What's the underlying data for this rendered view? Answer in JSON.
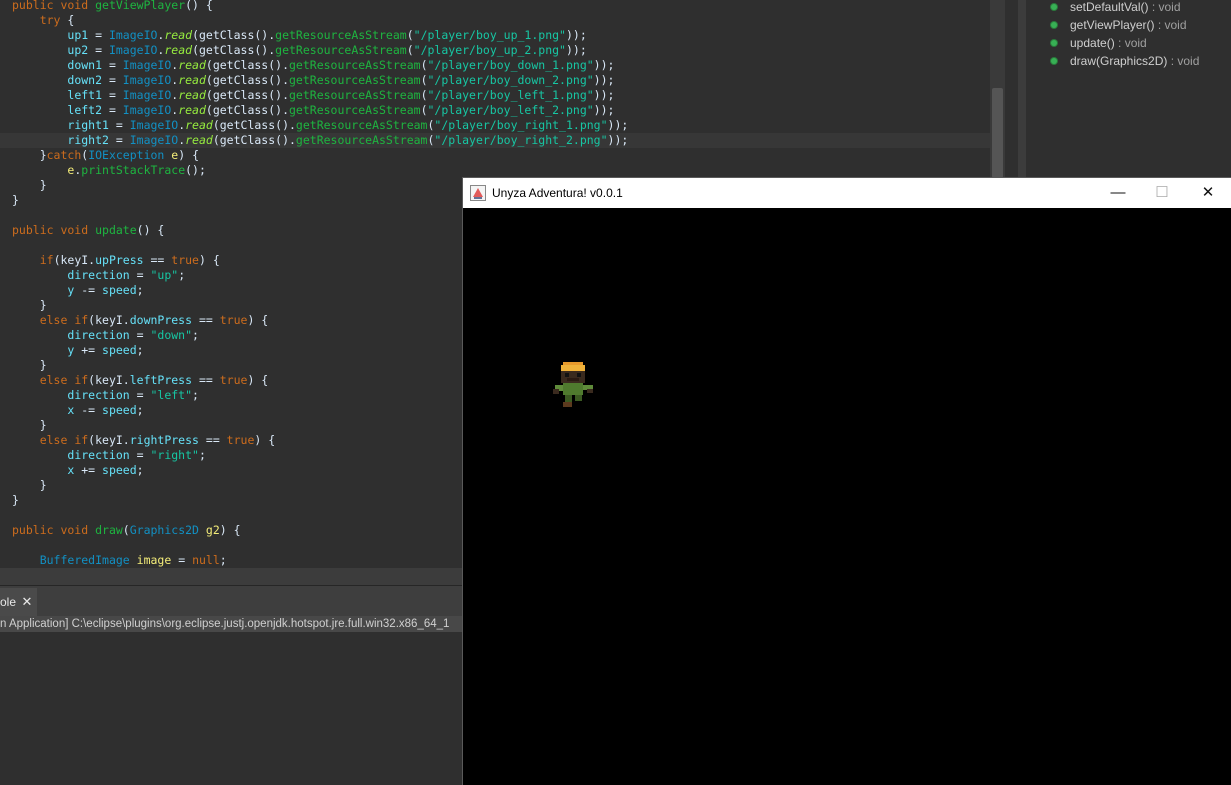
{
  "editor": {
    "lines": [
      [
        {
          "t": "public void ",
          "c": "kw"
        },
        {
          "t": "getViewPlayer",
          "c": "m"
        },
        {
          "t": "() {",
          "c": ""
        }
      ],
      [
        {
          "t": "    ",
          "c": ""
        },
        {
          "t": "try",
          "c": "kw"
        },
        {
          "t": " {",
          "c": ""
        }
      ],
      [
        {
          "t": "        ",
          "c": ""
        },
        {
          "t": "up1",
          "c": "f"
        },
        {
          "t": " = ",
          "c": ""
        },
        {
          "t": "ImageIO",
          "c": "ty"
        },
        {
          "t": ".",
          "c": ""
        },
        {
          "t": "read",
          "c": "st"
        },
        {
          "t": "(getClass().",
          "c": ""
        },
        {
          "t": "getResourceAsStream",
          "c": "m"
        },
        {
          "t": "(",
          "c": ""
        },
        {
          "t": "\"/player/boy_up_1.png\"",
          "c": "s"
        },
        {
          "t": "));",
          "c": ""
        }
      ],
      [
        {
          "t": "        ",
          "c": ""
        },
        {
          "t": "up2",
          "c": "f"
        },
        {
          "t": " = ",
          "c": ""
        },
        {
          "t": "ImageIO",
          "c": "ty"
        },
        {
          "t": ".",
          "c": ""
        },
        {
          "t": "read",
          "c": "st"
        },
        {
          "t": "(getClass().",
          "c": ""
        },
        {
          "t": "getResourceAsStream",
          "c": "m"
        },
        {
          "t": "(",
          "c": ""
        },
        {
          "t": "\"/player/boy_up_2.png\"",
          "c": "s"
        },
        {
          "t": "));",
          "c": ""
        }
      ],
      [
        {
          "t": "        ",
          "c": ""
        },
        {
          "t": "down1",
          "c": "f"
        },
        {
          "t": " = ",
          "c": ""
        },
        {
          "t": "ImageIO",
          "c": "ty"
        },
        {
          "t": ".",
          "c": ""
        },
        {
          "t": "read",
          "c": "st"
        },
        {
          "t": "(getClass().",
          "c": ""
        },
        {
          "t": "getResourceAsStream",
          "c": "m"
        },
        {
          "t": "(",
          "c": ""
        },
        {
          "t": "\"/player/boy_down_1.png\"",
          "c": "s"
        },
        {
          "t": "));",
          "c": ""
        }
      ],
      [
        {
          "t": "        ",
          "c": ""
        },
        {
          "t": "down2",
          "c": "f"
        },
        {
          "t": " = ",
          "c": ""
        },
        {
          "t": "ImageIO",
          "c": "ty"
        },
        {
          "t": ".",
          "c": ""
        },
        {
          "t": "read",
          "c": "st"
        },
        {
          "t": "(getClass().",
          "c": ""
        },
        {
          "t": "getResourceAsStream",
          "c": "m"
        },
        {
          "t": "(",
          "c": ""
        },
        {
          "t": "\"/player/boy_down_2.png\"",
          "c": "s"
        },
        {
          "t": "));",
          "c": ""
        }
      ],
      [
        {
          "t": "        ",
          "c": ""
        },
        {
          "t": "left1",
          "c": "f"
        },
        {
          "t": " = ",
          "c": ""
        },
        {
          "t": "ImageIO",
          "c": "ty"
        },
        {
          "t": ".",
          "c": ""
        },
        {
          "t": "read",
          "c": "st"
        },
        {
          "t": "(getClass().",
          "c": ""
        },
        {
          "t": "getResourceAsStream",
          "c": "m"
        },
        {
          "t": "(",
          "c": ""
        },
        {
          "t": "\"/player/boy_left_1.png\"",
          "c": "s"
        },
        {
          "t": "));",
          "c": ""
        }
      ],
      [
        {
          "t": "        ",
          "c": ""
        },
        {
          "t": "left2",
          "c": "f"
        },
        {
          "t": " = ",
          "c": ""
        },
        {
          "t": "ImageIO",
          "c": "ty"
        },
        {
          "t": ".",
          "c": ""
        },
        {
          "t": "read",
          "c": "st"
        },
        {
          "t": "(getClass().",
          "c": ""
        },
        {
          "t": "getResourceAsStream",
          "c": "m"
        },
        {
          "t": "(",
          "c": ""
        },
        {
          "t": "\"/player/boy_left_2.png\"",
          "c": "s"
        },
        {
          "t": "));",
          "c": ""
        }
      ],
      [
        {
          "t": "        ",
          "c": ""
        },
        {
          "t": "right1",
          "c": "f"
        },
        {
          "t": " = ",
          "c": ""
        },
        {
          "t": "ImageIO",
          "c": "ty"
        },
        {
          "t": ".",
          "c": ""
        },
        {
          "t": "read",
          "c": "st"
        },
        {
          "t": "(getClass().",
          "c": ""
        },
        {
          "t": "getResourceAsStream",
          "c": "m"
        },
        {
          "t": "(",
          "c": ""
        },
        {
          "t": "\"/player/boy_right_1.png\"",
          "c": "s"
        },
        {
          "t": "));",
          "c": ""
        }
      ],
      [
        {
          "t": "        ",
          "c": ""
        },
        {
          "t": "right2",
          "c": "f"
        },
        {
          "t": " = ",
          "c": ""
        },
        {
          "t": "ImageIO",
          "c": "ty"
        },
        {
          "t": ".",
          "c": ""
        },
        {
          "t": "read",
          "c": "st"
        },
        {
          "t": "(getClass().",
          "c": ""
        },
        {
          "t": "getResourceAsStream",
          "c": "m"
        },
        {
          "t": "(",
          "c": ""
        },
        {
          "t": "\"/player/boy_right_2.png\"",
          "c": "s"
        },
        {
          "t": "));",
          "c": ""
        }
      ],
      [
        {
          "t": "    }",
          "c": ""
        },
        {
          "t": "catch",
          "c": "kw"
        },
        {
          "t": "(",
          "c": ""
        },
        {
          "t": "IOException",
          "c": "ty"
        },
        {
          "t": " ",
          "c": ""
        },
        {
          "t": "e",
          "c": "v"
        },
        {
          "t": ") {",
          "c": ""
        }
      ],
      [
        {
          "t": "        ",
          "c": ""
        },
        {
          "t": "e",
          "c": "v"
        },
        {
          "t": ".",
          "c": ""
        },
        {
          "t": "printStackTrace",
          "c": "m"
        },
        {
          "t": "();",
          "c": ""
        }
      ],
      [
        {
          "t": "    }",
          "c": ""
        }
      ],
      [
        {
          "t": "}",
          "c": ""
        }
      ],
      [],
      [
        {
          "t": "public void ",
          "c": "kw"
        },
        {
          "t": "update",
          "c": "m"
        },
        {
          "t": "() {",
          "c": ""
        }
      ],
      [],
      [
        {
          "t": "    ",
          "c": ""
        },
        {
          "t": "if",
          "c": "kw"
        },
        {
          "t": "(keyI.",
          "c": ""
        },
        {
          "t": "upPress",
          "c": "f"
        },
        {
          "t": " == ",
          "c": ""
        },
        {
          "t": "true",
          "c": "kw"
        },
        {
          "t": ") {",
          "c": ""
        }
      ],
      [
        {
          "t": "        ",
          "c": ""
        },
        {
          "t": "direction",
          "c": "f"
        },
        {
          "t": " = ",
          "c": ""
        },
        {
          "t": "\"up\"",
          "c": "s"
        },
        {
          "t": ";",
          "c": ""
        }
      ],
      [
        {
          "t": "        ",
          "c": ""
        },
        {
          "t": "y",
          "c": "f"
        },
        {
          "t": " -= ",
          "c": ""
        },
        {
          "t": "speed",
          "c": "f"
        },
        {
          "t": ";",
          "c": ""
        }
      ],
      [
        {
          "t": "    }",
          "c": ""
        }
      ],
      [
        {
          "t": "    ",
          "c": ""
        },
        {
          "t": "else if",
          "c": "kw"
        },
        {
          "t": "(keyI.",
          "c": ""
        },
        {
          "t": "downPress",
          "c": "f"
        },
        {
          "t": " == ",
          "c": ""
        },
        {
          "t": "true",
          "c": "kw"
        },
        {
          "t": ") {",
          "c": ""
        }
      ],
      [
        {
          "t": "        ",
          "c": ""
        },
        {
          "t": "direction",
          "c": "f"
        },
        {
          "t": " = ",
          "c": ""
        },
        {
          "t": "\"down\"",
          "c": "s"
        },
        {
          "t": ";",
          "c": ""
        }
      ],
      [
        {
          "t": "        ",
          "c": ""
        },
        {
          "t": "y",
          "c": "f"
        },
        {
          "t": " += ",
          "c": ""
        },
        {
          "t": "speed",
          "c": "f"
        },
        {
          "t": ";",
          "c": ""
        }
      ],
      [
        {
          "t": "    }",
          "c": ""
        }
      ],
      [
        {
          "t": "    ",
          "c": ""
        },
        {
          "t": "else if",
          "c": "kw"
        },
        {
          "t": "(keyI.",
          "c": ""
        },
        {
          "t": "leftPress",
          "c": "f"
        },
        {
          "t": " == ",
          "c": ""
        },
        {
          "t": "true",
          "c": "kw"
        },
        {
          "t": ") {",
          "c": ""
        }
      ],
      [
        {
          "t": "        ",
          "c": ""
        },
        {
          "t": "direction",
          "c": "f"
        },
        {
          "t": " = ",
          "c": ""
        },
        {
          "t": "\"left\"",
          "c": "s"
        },
        {
          "t": ";",
          "c": ""
        }
      ],
      [
        {
          "t": "        ",
          "c": ""
        },
        {
          "t": "x",
          "c": "f"
        },
        {
          "t": " -= ",
          "c": ""
        },
        {
          "t": "speed",
          "c": "f"
        },
        {
          "t": ";",
          "c": ""
        }
      ],
      [
        {
          "t": "    }",
          "c": ""
        }
      ],
      [
        {
          "t": "    ",
          "c": ""
        },
        {
          "t": "else if",
          "c": "kw"
        },
        {
          "t": "(keyI.",
          "c": ""
        },
        {
          "t": "rightPress",
          "c": "f"
        },
        {
          "t": " == ",
          "c": ""
        },
        {
          "t": "true",
          "c": "kw"
        },
        {
          "t": ") {",
          "c": ""
        }
      ],
      [
        {
          "t": "        ",
          "c": ""
        },
        {
          "t": "direction",
          "c": "f"
        },
        {
          "t": " = ",
          "c": ""
        },
        {
          "t": "\"right\"",
          "c": "s"
        },
        {
          "t": ";",
          "c": ""
        }
      ],
      [
        {
          "t": "        ",
          "c": ""
        },
        {
          "t": "x",
          "c": "f"
        },
        {
          "t": " += ",
          "c": ""
        },
        {
          "t": "speed",
          "c": "f"
        },
        {
          "t": ";",
          "c": ""
        }
      ],
      [
        {
          "t": "    }",
          "c": ""
        }
      ],
      [
        {
          "t": "}",
          "c": ""
        }
      ],
      [],
      [
        {
          "t": "public void ",
          "c": "kw"
        },
        {
          "t": "draw",
          "c": "m"
        },
        {
          "t": "(",
          "c": ""
        },
        {
          "t": "Graphics2D",
          "c": "ty"
        },
        {
          "t": " ",
          "c": ""
        },
        {
          "t": "g2",
          "c": "v"
        },
        {
          "t": ") {",
          "c": ""
        }
      ],
      [],
      [
        {
          "t": "    ",
          "c": ""
        },
        {
          "t": "BufferedImage",
          "c": "ty"
        },
        {
          "t": " ",
          "c": ""
        },
        {
          "t": "image",
          "c": "v"
        },
        {
          "t": " = ",
          "c": ""
        },
        {
          "t": "null",
          "c": "kw"
        },
        {
          "t": ";",
          "c": ""
        }
      ]
    ],
    "highlighted_line": 9
  },
  "outline": {
    "items": [
      {
        "name": "setDefaultVal()",
        "ret": " : void"
      },
      {
        "name": "getViewPlayer()",
        "ret": " : void"
      },
      {
        "name": "update()",
        "ret": " : void"
      },
      {
        "name": "draw(Graphics2D)",
        "ret": " : void"
      }
    ]
  },
  "console": {
    "tab_label": "ole",
    "path": "n Application] C:\\eclipse\\plugins\\org.eclipse.justj.openjdk.hotspot.jre.full.win32.x86_64_1"
  },
  "game_window": {
    "title": "Unyza Adventura! v0.0.1",
    "minimize_icon": "—",
    "maximize_icon": "☐",
    "close_icon": "✕"
  },
  "colors": {
    "editor_bg": "#2f2f2f",
    "keyword": "#cc6c1d",
    "method": "#1eb540",
    "string": "#17c6a3",
    "type": "#1290c3",
    "field": "#66e1f8",
    "variable": "#f3ec79",
    "game_bg": "#000000"
  }
}
